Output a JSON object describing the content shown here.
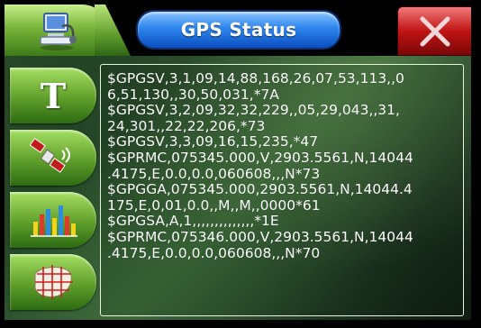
{
  "window": {
    "title": "GPS Status"
  },
  "icons": {
    "home": "computer-headset-icon",
    "close": "close-x-icon",
    "text_mode": "text-t-icon",
    "satellite": "satellite-icon",
    "signal_chart": "signal-bars-icon",
    "map_grid": "map-grid-icon"
  },
  "colors": {
    "accent_green": "#6fae30",
    "title_blue": "#2e86ee",
    "close_red": "#c01414",
    "text": "#ffffff"
  },
  "side_buttons": [
    {
      "label": "T"
    }
  ],
  "nmea": {
    "lines": [
      "$GPGSV,3,1,09,14,88,168,26,07,53,113,,0",
      "6,51,130,,30,50,031,*7A",
      "$GPGSV,3,2,09,32,32,229,,05,29,043,,31,",
      "24,301,,22,22,206,*73",
      "$GPGSV,3,3,09,16,15,235,*47",
      "$GPRMC,075345.000,V,2903.5561,N,14044",
      ".4175,E,0.0,0.0,060608,,,N*73",
      "$GPGGA,075345.000,2903.5561,N,14044.4",
      "175,E,0,01,0.0,,M,,M,,0000*61",
      "$GPGSA,A,1,,,,,,,,,,,,,,*1E",
      "$GPRMC,075346.000,V,2903.5561,N,14044",
      ".4175,E,0.0,0.0,060608,,,N*70"
    ]
  }
}
